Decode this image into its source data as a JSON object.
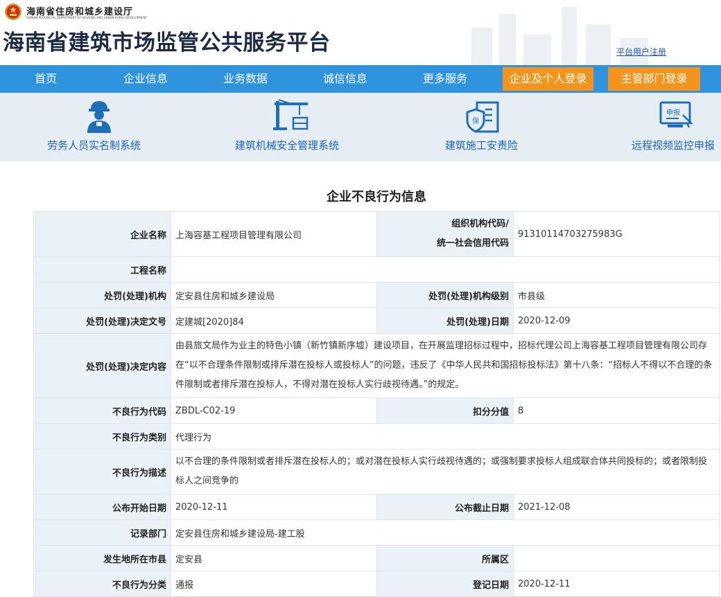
{
  "header": {
    "dept_cn": "海南省住房和城乡建设厅",
    "dept_en": "HAINAN PROVINCIAL DEPARTMENT OF HOUSING AND URBAN-RURAL DEVELOPMENT",
    "site_title": "海南省建筑市场监管公共服务平台",
    "register_link": "平台用户注册"
  },
  "nav": {
    "items": [
      "首页",
      "企业信息",
      "业务数据",
      "诚信信息",
      "更多服务"
    ],
    "login_buttons": [
      "企业及个人登录",
      "主管部门登录"
    ]
  },
  "systems": [
    {
      "label": "劳务人员实名制系统",
      "icon": "worker-icon"
    },
    {
      "label": "建筑机械安全管理系统",
      "icon": "crane-icon"
    },
    {
      "label": "建筑施工安责险",
      "icon": "insurance-building-icon"
    },
    {
      "label": "远程视频监控申报",
      "icon": "monitor-report-icon"
    }
  ],
  "section_title": "企业不良行为信息",
  "info": {
    "company_label": "企业名称",
    "company_value": "上海容基工程项目管理有限公司",
    "org_code_label_1": "组织机构代码/",
    "org_code_label_2": "统一社会信用代码",
    "org_code_value": "91310114703275983G",
    "project_label": "工程名称",
    "project_value": "",
    "agency_label": "处罚(处理)机构",
    "agency_value": "定安县住房和城乡建设局",
    "agency_level_label": "处罚(处理)机构级别",
    "agency_level_value": "市县级",
    "doc_no_label": "处罚(处理)决定文号",
    "doc_no_value": "定建城[2020]84",
    "date_label": "处罚(处理)日期",
    "date_value": "2020-12-09",
    "content_label": "处罚(处理)决定内容",
    "content_value": "由县旅文局作为业主的特色小镇（新竹镇新序墟）建设项目，在开展监理招标过程中，招标代理公司上海容基工程项目管理有限公司存在“以不合理条件限制或排斥潜在投标人或投标人”的问题，违反了《中华人民共和国招标投标法》第十八条：“招标人不得以不合理的条件限制或者排斥潜在投标人，不得对潜在投标人实行歧视待遇。”的规定。",
    "bad_code_label": "不良行为代码",
    "bad_code_value": "ZBDL-C02-19",
    "score_label": "扣分分值",
    "score_value": "8",
    "category_label": "不良行为类别",
    "category_value": "代理行为",
    "desc_label": "不良行为描述",
    "desc_value": "以不合理的条件限制或者排斥潜在投标人的；或对潜在投标人实行歧视待遇的；或强制要求投标人组成联合体共同投标的；或者限制投标人之间竞争的",
    "pub_start_label": "公布开始日期",
    "pub_start_value": "2020-12-11",
    "pub_end_label": "公布截止日期",
    "pub_end_value": "2021-12-08",
    "record_dept_label": "记录部门",
    "record_dept_value": "定安县住房和城乡建设局-建工股",
    "city_label": "发生地所在市县",
    "city_value": "定安县",
    "district_label": "所属区",
    "district_value": "",
    "class_label": "不良行为分类",
    "class_value": "通报",
    "reg_date_label": "登记日期",
    "reg_date_value": "2020-12-11"
  },
  "colors": {
    "nav_bg": "#2f93dd",
    "login_btn": "#f5941d",
    "system_bar_bg": "#e6eef4",
    "system_label": "#1a63b0",
    "label_cell_bg": "#eaf1f7"
  }
}
